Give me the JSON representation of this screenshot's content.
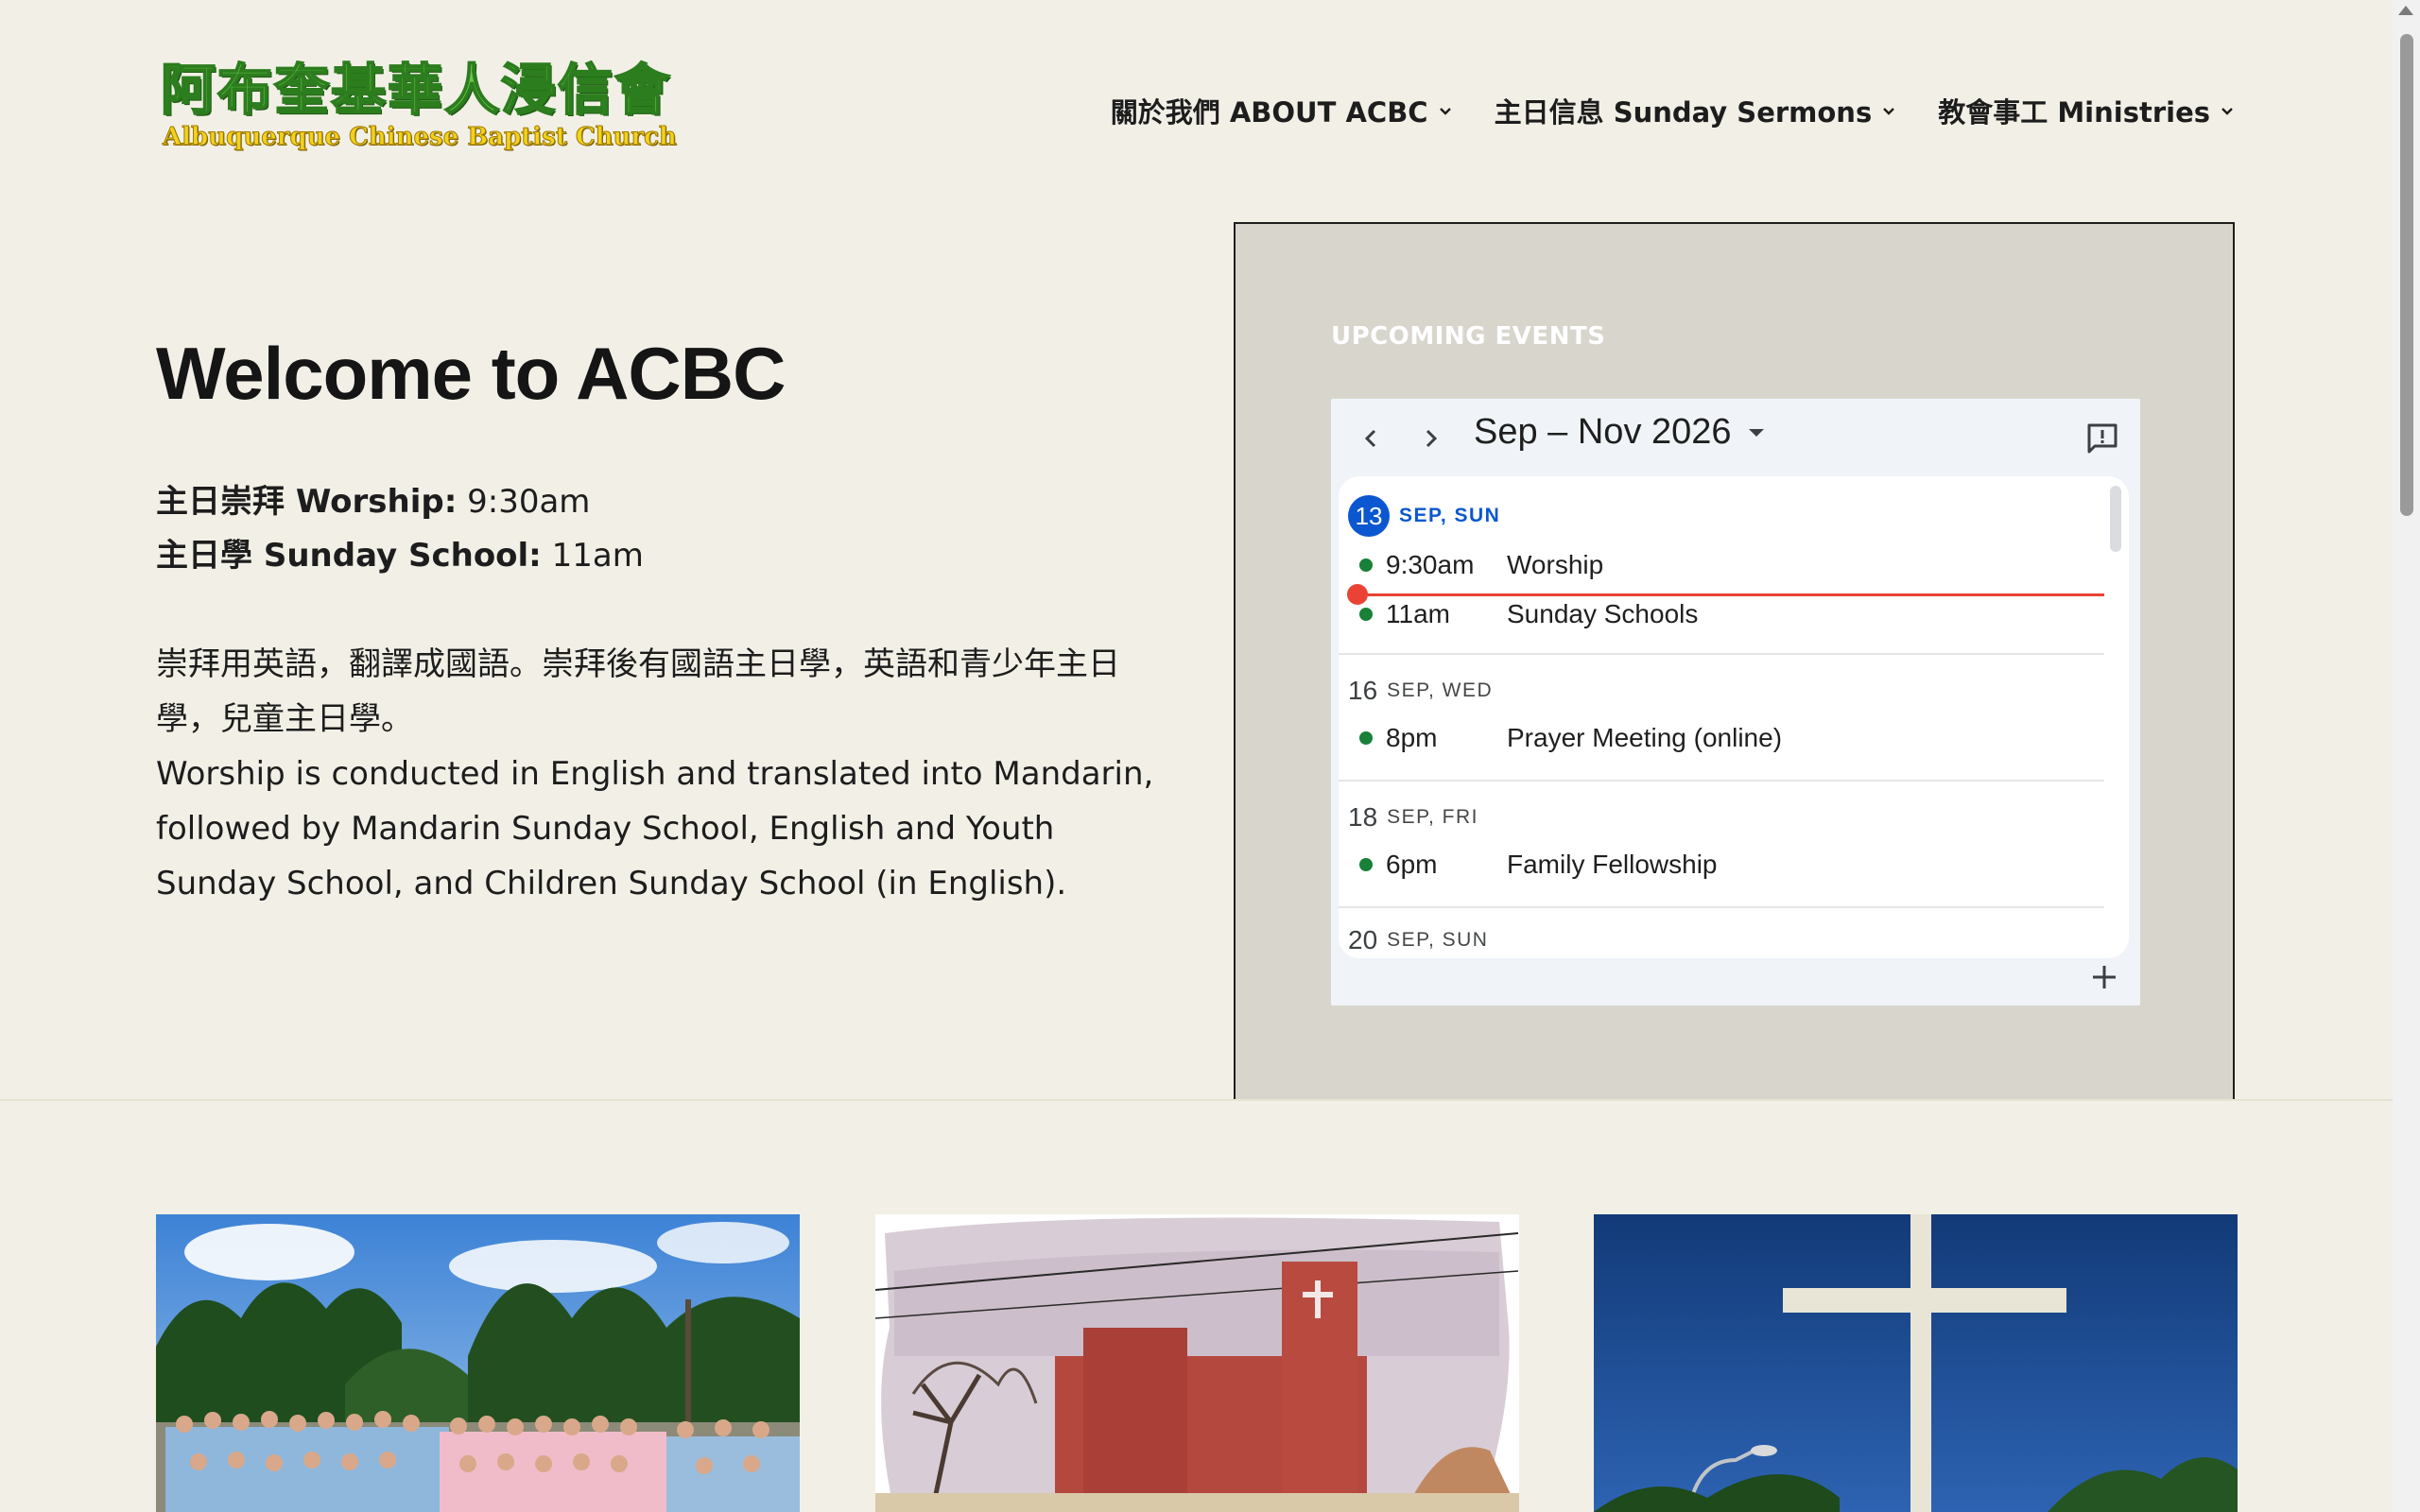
{
  "site": {
    "logo_cn": "阿布奎基華人浸信會",
    "logo_en": "Albuquerque Chinese Baptist Church"
  },
  "nav": {
    "items": [
      {
        "label": "關於我們 ABOUT ACBC",
        "icon": "chevron-down-icon"
      },
      {
        "label": "主日信息 Sunday Sermons",
        "icon": "chevron-down-icon"
      },
      {
        "label": "教會事工 Ministries",
        "icon": "chevron-down-icon"
      }
    ]
  },
  "hero": {
    "title": "Welcome to ACBC",
    "worship_label": "主日崇拜 Worship:",
    "worship_time": " 9:30am",
    "school_label": "主日學 Sunday School:",
    "school_time": " 11am",
    "desc_cn": "崇拜用英語，翻譯成國語。崇拜後有國語主日學，英語和青少年主日學，兒童主日學。",
    "desc_en": "Worship is conducted in English and translated into Mandarin, followed by Mandarin Sunday School, English and Youth Sunday School, and Children Sunday School (in English)."
  },
  "events": {
    "title": "UPCOMING EVENTS",
    "range": "Sep – Nov 2026",
    "days": [
      {
        "num": "13",
        "label": "SEP, SUN",
        "today": true,
        "events": [
          {
            "time": "9:30am",
            "title": "Worship"
          },
          {
            "time": "11am",
            "title": "Sunday Schools"
          }
        ]
      },
      {
        "num": "16",
        "label": "SEP, WED",
        "events": [
          {
            "time": "8pm",
            "title": "Prayer Meeting (online)"
          }
        ]
      },
      {
        "num": "18",
        "label": "SEP, FRI",
        "events": [
          {
            "time": "6pm",
            "title": "Family Fellowship"
          }
        ]
      },
      {
        "num": "20",
        "label": "SEP, SUN",
        "events": []
      }
    ],
    "colors": {
      "event_dot": "#188038",
      "today": "#0b57d0",
      "now_line": "#ea4335"
    }
  },
  "thumbnails": [
    {
      "name": "group-photo"
    },
    {
      "name": "church-building"
    },
    {
      "name": "cross"
    }
  ],
  "colors": {
    "page_bg": "#f2f0e6",
    "panel_bg": "#d8d6cc",
    "logo_green": "#6cc84a",
    "logo_yellow": "#f2d21c"
  }
}
